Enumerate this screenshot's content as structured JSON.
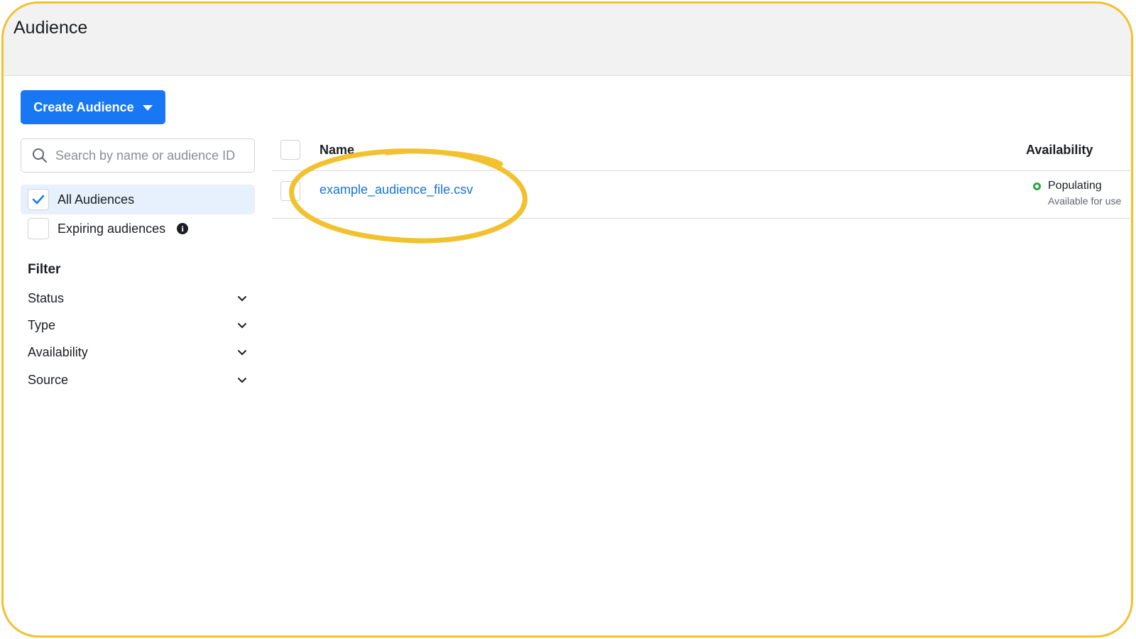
{
  "header": {
    "title": "Audience"
  },
  "toolbar": {
    "create_label": "Create Audience"
  },
  "search": {
    "placeholder": "Search by name or audience ID",
    "value": ""
  },
  "sidebar": {
    "views": [
      {
        "label": "All Audiences",
        "checked": true
      },
      {
        "label": "Expiring audiences",
        "checked": false
      }
    ],
    "filter_title": "Filter",
    "filters": [
      {
        "label": "Status"
      },
      {
        "label": "Type"
      },
      {
        "label": "Availability"
      },
      {
        "label": "Source"
      }
    ]
  },
  "table": {
    "columns": {
      "name": "Name",
      "availability": "Availability"
    },
    "rows": [
      {
        "name": "example_audience_file.csv",
        "status": "Populating",
        "status_detail": "Available for use"
      }
    ]
  },
  "colors": {
    "accent": "#1877f2",
    "highlight": "#f2c12e",
    "status_ok": "#31a24c",
    "link": "#1a73d9"
  }
}
